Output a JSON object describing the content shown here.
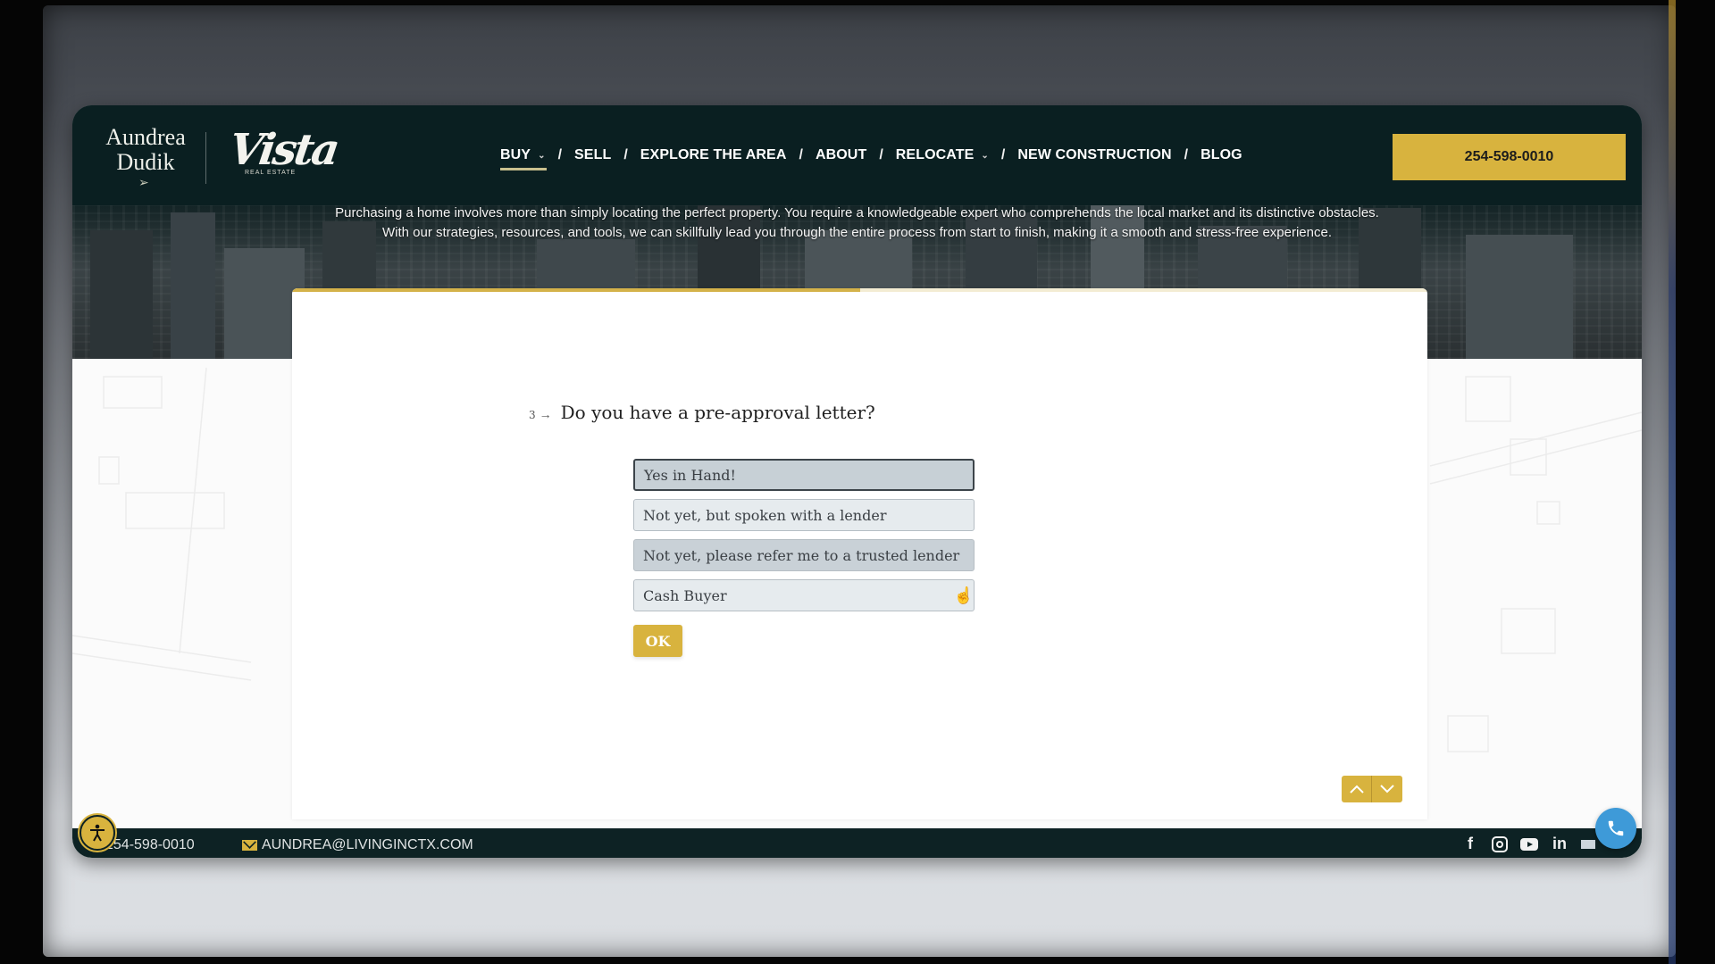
{
  "brand": {
    "name_line1": "Aundrea",
    "name_line2": "Dudik",
    "partner_logo": "Vista",
    "partner_sub": "REAL ESTATE"
  },
  "nav": {
    "items": [
      {
        "label": "BUY",
        "has_dropdown": true,
        "active": true
      },
      {
        "label": "SELL",
        "has_dropdown": false
      },
      {
        "label": "EXPLORE THE AREA",
        "has_dropdown": false
      },
      {
        "label": "ABOUT",
        "has_dropdown": false
      },
      {
        "label": "RELOCATE",
        "has_dropdown": true
      },
      {
        "label": "NEW CONSTRUCTION",
        "has_dropdown": false
      },
      {
        "label": "BLOG",
        "has_dropdown": false
      }
    ],
    "separator": "/",
    "dropdown_icon": "chevron-down-icon"
  },
  "header_cta": {
    "label": "254-598-0010"
  },
  "intro": {
    "line1": "Purchasing a home involves more than simply locating the perfect property. You require a knowledgeable expert who comprehends the local market and its distinctive obstacles.",
    "line2": "With our strategies, resources, and tools, we can skillfully lead you through the entire process from start to finish, making it a smooth and stress-free experience."
  },
  "form": {
    "progress_percent": 50,
    "question_number": "3",
    "question_arrow": "→",
    "question": "Do you have a pre-approval letter?",
    "options": [
      {
        "label": "Yes in Hand!",
        "state": "selected"
      },
      {
        "label": "Not yet, but spoken with a lender",
        "state": "default"
      },
      {
        "label": "Not yet, please refer me to a trusted lender",
        "state": "hover"
      },
      {
        "label": "Cash Buyer",
        "state": "default"
      }
    ],
    "ok_label": "OK",
    "prev_icon": "chevron-up-icon",
    "next_icon": "chevron-down-icon"
  },
  "footer": {
    "phone": "254-598-0010",
    "email": "AUNDREA@LIVINGINCTX.COM",
    "social": [
      "facebook-icon",
      "instagram-icon",
      "youtube-icon",
      "linkedin-icon"
    ]
  },
  "colors": {
    "brand_dark": "#0a1f21",
    "accent_gold": "#d8b33e",
    "call_blue": "#3e9ad8"
  }
}
